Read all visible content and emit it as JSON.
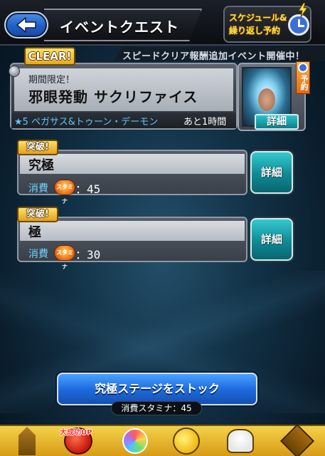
{
  "header": {
    "title": "イベントクエスト",
    "schedule_line1": "スケジュール&",
    "schedule_line2": "繰り返し予約"
  },
  "ticker": {
    "text": "スピードクリア報酬追加イベント開催中！"
  },
  "quest": {
    "clear_label": "CLEAR!",
    "subtitle": "期間限定！",
    "name": "邪眼発動 サクリファイス",
    "monster": "★5 ペガサス&トゥーン・デーモン",
    "remaining": "あと1時間",
    "reserve_label": "予約",
    "detail_label": "詳細"
  },
  "difficulties": [
    {
      "badge": "突破!",
      "name": "究極",
      "stamina_label": "消費",
      "stamina_icon_text": "スタミナ",
      "stamina_value": "：45",
      "detail_label": "詳細"
    },
    {
      "badge": "突破!",
      "name": "極",
      "stamina_label": "消費",
      "stamina_icon_text": "スタミナ",
      "stamina_value": "：30",
      "detail_label": "詳細"
    }
  ],
  "stock": {
    "button_label": "究極ステージをストック",
    "cost": "消費スタミナ：45"
  },
  "bottom_nav": {
    "success_up": "大成功UP",
    "items": [
      "home-icon",
      "gacha-icon",
      "orb-icon",
      "monster-box-icon",
      "friends-icon",
      "menu-icon"
    ]
  },
  "colors": {
    "accent_blue": "#1e6ce0",
    "detail_teal": "#0f8a95",
    "badge_gold": "#e3a11c",
    "monster_text": "#5cc6ff"
  }
}
